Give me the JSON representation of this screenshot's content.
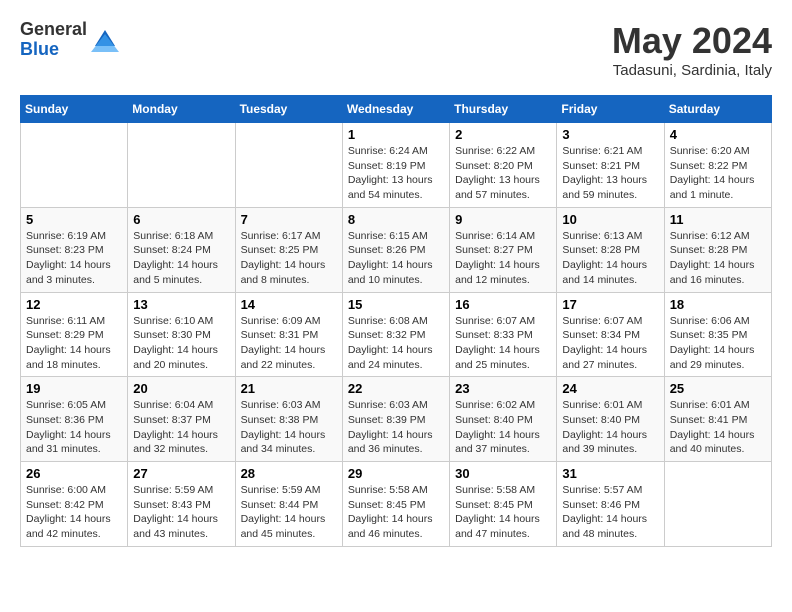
{
  "header": {
    "logo_general": "General",
    "logo_blue": "Blue",
    "month_title": "May 2024",
    "subtitle": "Tadasuni, Sardinia, Italy"
  },
  "weekdays": [
    "Sunday",
    "Monday",
    "Tuesday",
    "Wednesday",
    "Thursday",
    "Friday",
    "Saturday"
  ],
  "weeks": [
    [
      {
        "day": "",
        "info": ""
      },
      {
        "day": "",
        "info": ""
      },
      {
        "day": "",
        "info": ""
      },
      {
        "day": "1",
        "info": "Sunrise: 6:24 AM\nSunset: 8:19 PM\nDaylight: 13 hours\nand 54 minutes."
      },
      {
        "day": "2",
        "info": "Sunrise: 6:22 AM\nSunset: 8:20 PM\nDaylight: 13 hours\nand 57 minutes."
      },
      {
        "day": "3",
        "info": "Sunrise: 6:21 AM\nSunset: 8:21 PM\nDaylight: 13 hours\nand 59 minutes."
      },
      {
        "day": "4",
        "info": "Sunrise: 6:20 AM\nSunset: 8:22 PM\nDaylight: 14 hours\nand 1 minute."
      }
    ],
    [
      {
        "day": "5",
        "info": "Sunrise: 6:19 AM\nSunset: 8:23 PM\nDaylight: 14 hours\nand 3 minutes."
      },
      {
        "day": "6",
        "info": "Sunrise: 6:18 AM\nSunset: 8:24 PM\nDaylight: 14 hours\nand 5 minutes."
      },
      {
        "day": "7",
        "info": "Sunrise: 6:17 AM\nSunset: 8:25 PM\nDaylight: 14 hours\nand 8 minutes."
      },
      {
        "day": "8",
        "info": "Sunrise: 6:15 AM\nSunset: 8:26 PM\nDaylight: 14 hours\nand 10 minutes."
      },
      {
        "day": "9",
        "info": "Sunrise: 6:14 AM\nSunset: 8:27 PM\nDaylight: 14 hours\nand 12 minutes."
      },
      {
        "day": "10",
        "info": "Sunrise: 6:13 AM\nSunset: 8:28 PM\nDaylight: 14 hours\nand 14 minutes."
      },
      {
        "day": "11",
        "info": "Sunrise: 6:12 AM\nSunset: 8:28 PM\nDaylight: 14 hours\nand 16 minutes."
      }
    ],
    [
      {
        "day": "12",
        "info": "Sunrise: 6:11 AM\nSunset: 8:29 PM\nDaylight: 14 hours\nand 18 minutes."
      },
      {
        "day": "13",
        "info": "Sunrise: 6:10 AM\nSunset: 8:30 PM\nDaylight: 14 hours\nand 20 minutes."
      },
      {
        "day": "14",
        "info": "Sunrise: 6:09 AM\nSunset: 8:31 PM\nDaylight: 14 hours\nand 22 minutes."
      },
      {
        "day": "15",
        "info": "Sunrise: 6:08 AM\nSunset: 8:32 PM\nDaylight: 14 hours\nand 24 minutes."
      },
      {
        "day": "16",
        "info": "Sunrise: 6:07 AM\nSunset: 8:33 PM\nDaylight: 14 hours\nand 25 minutes."
      },
      {
        "day": "17",
        "info": "Sunrise: 6:07 AM\nSunset: 8:34 PM\nDaylight: 14 hours\nand 27 minutes."
      },
      {
        "day": "18",
        "info": "Sunrise: 6:06 AM\nSunset: 8:35 PM\nDaylight: 14 hours\nand 29 minutes."
      }
    ],
    [
      {
        "day": "19",
        "info": "Sunrise: 6:05 AM\nSunset: 8:36 PM\nDaylight: 14 hours\nand 31 minutes."
      },
      {
        "day": "20",
        "info": "Sunrise: 6:04 AM\nSunset: 8:37 PM\nDaylight: 14 hours\nand 32 minutes."
      },
      {
        "day": "21",
        "info": "Sunrise: 6:03 AM\nSunset: 8:38 PM\nDaylight: 14 hours\nand 34 minutes."
      },
      {
        "day": "22",
        "info": "Sunrise: 6:03 AM\nSunset: 8:39 PM\nDaylight: 14 hours\nand 36 minutes."
      },
      {
        "day": "23",
        "info": "Sunrise: 6:02 AM\nSunset: 8:40 PM\nDaylight: 14 hours\nand 37 minutes."
      },
      {
        "day": "24",
        "info": "Sunrise: 6:01 AM\nSunset: 8:40 PM\nDaylight: 14 hours\nand 39 minutes."
      },
      {
        "day": "25",
        "info": "Sunrise: 6:01 AM\nSunset: 8:41 PM\nDaylight: 14 hours\nand 40 minutes."
      }
    ],
    [
      {
        "day": "26",
        "info": "Sunrise: 6:00 AM\nSunset: 8:42 PM\nDaylight: 14 hours\nand 42 minutes."
      },
      {
        "day": "27",
        "info": "Sunrise: 5:59 AM\nSunset: 8:43 PM\nDaylight: 14 hours\nand 43 minutes."
      },
      {
        "day": "28",
        "info": "Sunrise: 5:59 AM\nSunset: 8:44 PM\nDaylight: 14 hours\nand 45 minutes."
      },
      {
        "day": "29",
        "info": "Sunrise: 5:58 AM\nSunset: 8:45 PM\nDaylight: 14 hours\nand 46 minutes."
      },
      {
        "day": "30",
        "info": "Sunrise: 5:58 AM\nSunset: 8:45 PM\nDaylight: 14 hours\nand 47 minutes."
      },
      {
        "day": "31",
        "info": "Sunrise: 5:57 AM\nSunset: 8:46 PM\nDaylight: 14 hours\nand 48 minutes."
      },
      {
        "day": "",
        "info": ""
      }
    ]
  ]
}
